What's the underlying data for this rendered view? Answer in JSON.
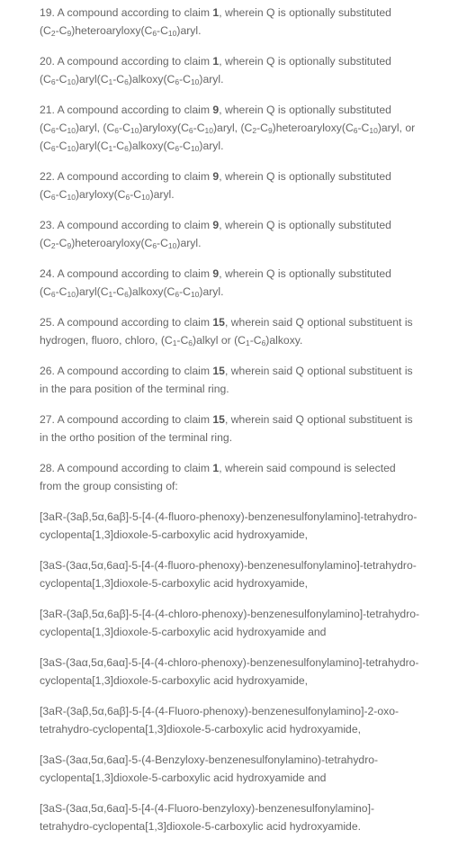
{
  "claims": [
    {
      "id": "19",
      "lines": [
        "19. A compound according to claim <b>1</b>, wherein Q is optionally substituted",
        "(C<sub>2</sub>-C<sub>9</sub>)heteroaryloxy(C<sub>6</sub>-C<sub>10</sub>)aryl."
      ]
    },
    {
      "id": "20",
      "lines": [
        "20. A compound according to claim <b>1</b>, wherein Q is optionally substituted",
        "(C<sub>6</sub>-C<sub>10</sub>)aryl(C<sub>1</sub>-C<sub>6</sub>)alkoxy(C<sub>6</sub>-C<sub>10</sub>)aryl."
      ]
    },
    {
      "id": "21",
      "lines": [
        "21. A compound according to claim <b>9</b>, wherein Q is optionally substituted",
        "(C<sub>6</sub>-C<sub>10</sub>)aryl, (C<sub>6</sub>-C<sub>10</sub>)aryloxy(C<sub>6</sub>-C<sub>10</sub>)aryl, (C<sub>2</sub>-C<sub>9</sub>)heteroaryloxy(C<sub>6</sub>-C<sub>10</sub>)aryl, or",
        "(C<sub>6</sub>-C<sub>10</sub>)aryl(C<sub>1</sub>-C<sub>6</sub>)alkoxy(C<sub>6</sub>-C<sub>10</sub>)aryl."
      ]
    },
    {
      "id": "22",
      "lines": [
        "22. A compound according to claim <b>9</b>, wherein Q is optionally substituted",
        "(C<sub>6</sub>-C<sub>10</sub>)aryloxy(C<sub>6</sub>-C<sub>10</sub>)aryl."
      ]
    },
    {
      "id": "23",
      "lines": [
        "23. A compound according to claim <b>9</b>, wherein Q is optionally substituted",
        "(C<sub>2</sub>-C<sub>9</sub>)heteroaryloxy(C<sub>6</sub>-C<sub>10</sub>)aryl."
      ]
    },
    {
      "id": "24",
      "lines": [
        "24. A compound according to claim <b>9</b>, wherein Q is optionally substituted",
        "(C<sub>6</sub>-C<sub>10</sub>)aryl(C<sub>1</sub>-C<sub>6</sub>)alkoxy(C<sub>6</sub>-C<sub>10</sub>)aryl."
      ]
    },
    {
      "id": "25",
      "lines": [
        "25. A compound according to claim <b>15</b>, wherein said Q optional substituent is",
        "hydrogen, fluoro, chloro, (C<sub>1</sub>-C<sub>6</sub>)alkyl or (C<sub>1</sub>-C<sub>6</sub>)alkoxy."
      ]
    },
    {
      "id": "26",
      "lines": [
        "26. A compound according to claim <b>15</b>, wherein said Q optional substituent is",
        "in the para position of the terminal ring."
      ]
    },
    {
      "id": "27",
      "lines": [
        "27. A compound according to claim <b>15</b>, wherein said Q optional substituent is",
        "in the ortho position of the terminal ring."
      ]
    },
    {
      "id": "28",
      "lines": [
        "28. A compound according to claim <b>1</b>, wherein said compound is selected",
        "from the group consisting of:"
      ]
    },
    {
      "id": "28a",
      "lines": [
        "[3aR-(3aβ,5α,6aβ]-5-[4-(4-fluoro-phenoxy)-benzenesulfonylamino]-tetrahydro-",
        "cyclopenta[1,3]dioxole-5-carboxylic acid hydroxyamide,"
      ]
    },
    {
      "id": "28b",
      "lines": [
        "[3aS-(3aα,5α,6aα]-5-[4-(4-fluoro-phenoxy)-benzenesulfonylamino]-tetrahydro-",
        "cyclopenta[1,3]dioxole-5-carboxylic acid hydroxyamide,"
      ]
    },
    {
      "id": "28c",
      "lines": [
        "[3aR-(3aβ,5α,6aβ]-5-[4-(4-chloro-phenoxy)-benzenesulfonylamino]-tetrahydro-",
        "cyclopenta[1,3]dioxole-5-carboxylic acid hydroxyamide and"
      ]
    },
    {
      "id": "28d",
      "lines": [
        "[3aS-(3aα,5α,6aα]-5-[4-(4-chloro-phenoxy)-benzenesulfonylamino]-tetrahydro-",
        "cyclopenta[1,3]dioxole-5-carboxylic acid hydroxyamide,"
      ]
    },
    {
      "id": "28e",
      "lines": [
        "[3aR-(3aβ,5α,6aβ]-5-[4-(4-Fluoro-phenoxy)-benzenesulfonylamino]-2-oxo-",
        "tetrahydro-cyclopenta[1,3]dioxole-5-carboxylic acid hydroxyamide,"
      ]
    },
    {
      "id": "28f",
      "lines": [
        "[3aS-(3aα,5α,6aα]-5-(4-Benzyloxy-benzenesulfonylamino)-tetrahydro-",
        "cyclopenta[1,3]dioxole-5-carboxylic acid hydroxyamide and"
      ]
    },
    {
      "id": "28g",
      "lines": [
        "[3aS-(3aα,5α,6aα]-5-[4-(4-Fluoro-benzyloxy)-benzenesulfonylamino]-",
        "tetrahydro-cyclopenta[1,3]dioxole-5-carboxylic acid hydroxyamide."
      ]
    }
  ]
}
